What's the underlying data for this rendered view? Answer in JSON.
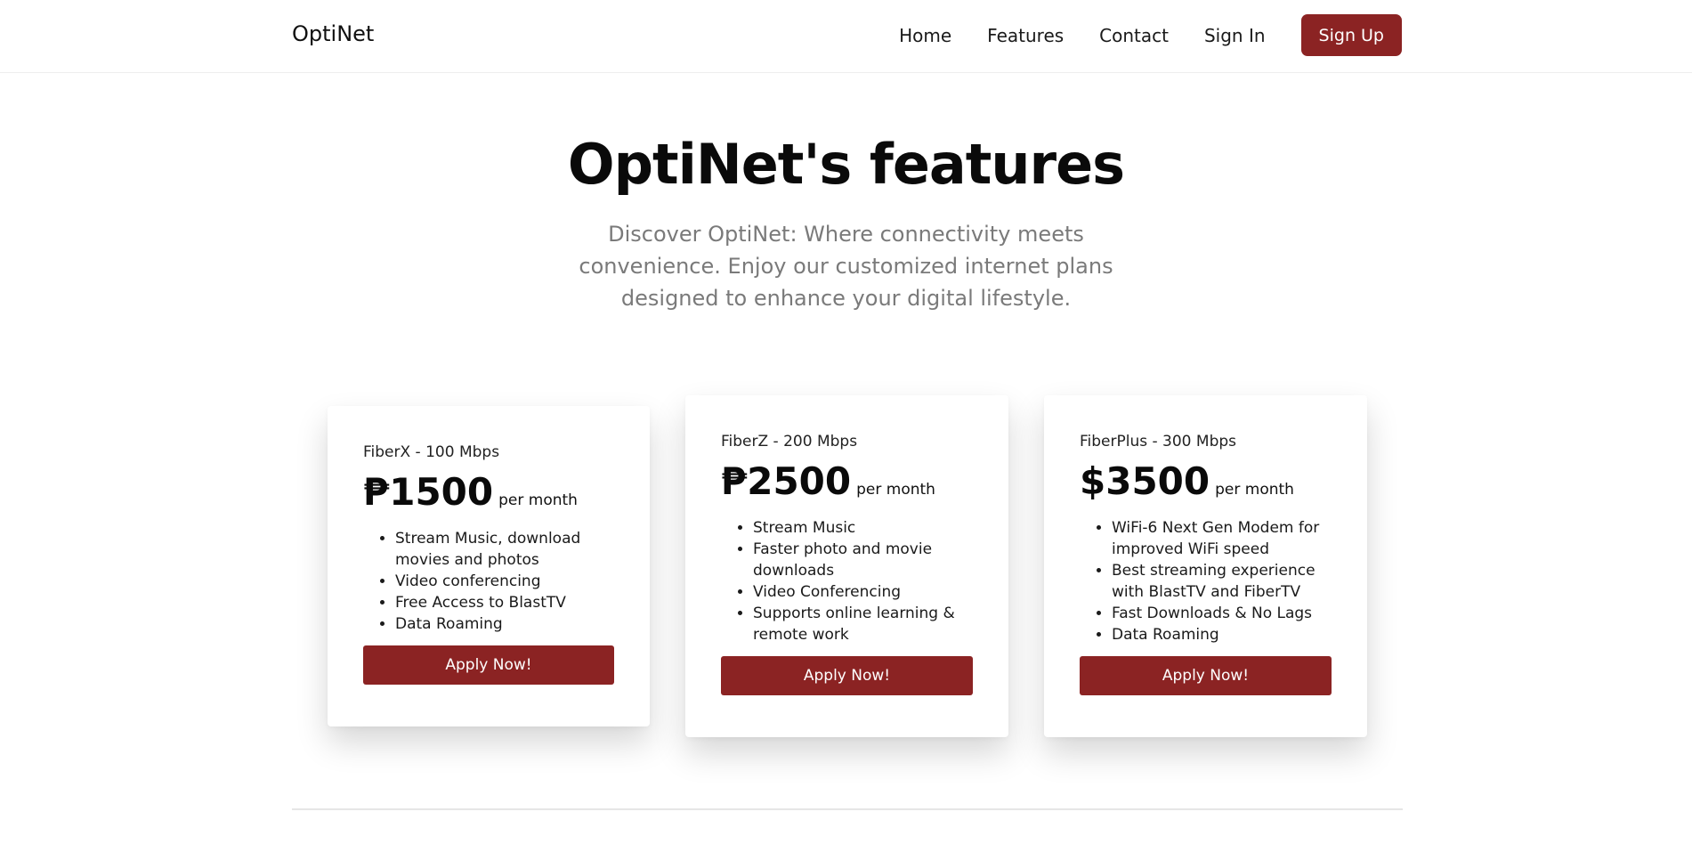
{
  "navbar": {
    "brand": "OptiNet",
    "links": [
      "Home",
      "Features",
      "Contact",
      "Sign In"
    ],
    "signup_label": "Sign Up"
  },
  "hero": {
    "title": "OptiNet's features",
    "subtitle": "Discover OptiNet: Where connectivity meets convenience. Enjoy our customized internet plans designed to enhance your digital lifestyle."
  },
  "plans": [
    {
      "name": "FiberX - 100 Mbps",
      "price": "₱1500",
      "period": "per month",
      "features": [
        "Stream Music, download movies and photos",
        "Video conferencing",
        "Free Access to BlastTV",
        "Data Roaming"
      ],
      "button": "Apply Now!"
    },
    {
      "name": "FiberZ - 200 Mbps",
      "price": "₱2500",
      "period": "per month",
      "features": [
        "Stream Music",
        "Faster photo and movie downloads",
        "Video Conferencing",
        "Supports online learning & remote work"
      ],
      "button": "Apply Now!"
    },
    {
      "name": "FiberPlus - 300 Mbps",
      "price": "$3500",
      "period": "per month",
      "features": [
        "WiFi-6 Next Gen Modem for improved WiFi speed",
        "Best streaming experience with BlastTV and FiberTV",
        "Fast Downloads & No Lags",
        "Data Roaming"
      ],
      "button": "Apply Now!"
    }
  ],
  "colors": {
    "accent": "#8b2323",
    "subtitle": "#7a7a7a"
  }
}
